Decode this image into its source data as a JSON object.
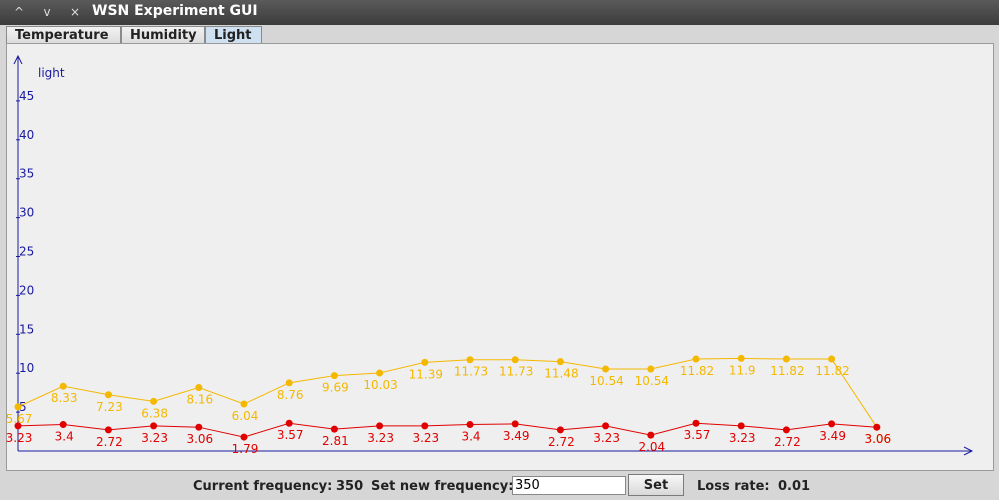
{
  "window": {
    "title": "WSN Experiment GUI",
    "buttons": [
      "^",
      "v",
      "×"
    ]
  },
  "tabs": [
    {
      "label": "Temperature",
      "active": false
    },
    {
      "label": "Humidity",
      "active": false
    },
    {
      "label": "Light",
      "active": true
    }
  ],
  "chart_data": {
    "type": "line",
    "ylabel": "light",
    "ylim": [
      0,
      45
    ],
    "yticks": [
      5,
      10,
      15,
      20,
      25,
      30,
      35,
      40,
      45
    ],
    "grid": false,
    "series": [
      {
        "color": "#f5b800",
        "values": [
          5.67,
          8.33,
          7.23,
          6.38,
          8.16,
          6.04,
          8.76,
          9.69,
          10.03,
          11.39,
          11.73,
          11.73,
          11.48,
          10.54,
          10.54,
          11.82,
          11.9,
          11.82,
          11.82,
          3.06
        ]
      },
      {
        "color": "#e00000",
        "values": [
          3.23,
          3.4,
          2.72,
          3.23,
          3.06,
          1.79,
          3.57,
          2.81,
          3.23,
          3.23,
          3.4,
          3.49,
          2.72,
          3.23,
          2.04,
          3.57,
          3.23,
          2.72,
          3.49,
          3.06
        ]
      }
    ]
  },
  "footer": {
    "current_label": "Current frequency:",
    "current_value": "350",
    "set_label": "Set new frequency:",
    "input_value": "350",
    "set_button": "Set",
    "loss_label": "Loss rate:",
    "loss_value": "0.01"
  }
}
